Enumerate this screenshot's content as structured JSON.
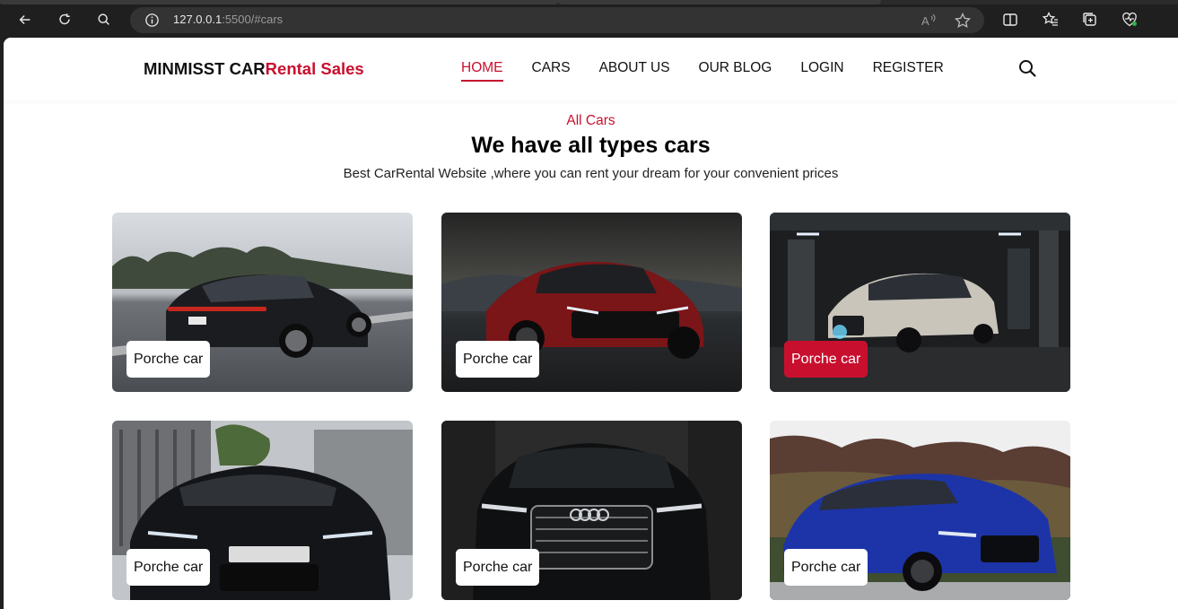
{
  "browser": {
    "url_host": "127.0.0.1",
    "url_rest": ":5500/#cars",
    "icons": [
      "back-icon",
      "refresh-icon",
      "search-icon",
      "info-icon",
      "read-aloud-icon",
      "favorite-star-icon",
      "split-screen-icon",
      "favorites-icon",
      "collections-icon",
      "browser-essentials-icon"
    ]
  },
  "header": {
    "logo_main": "MINMISST CAR",
    "logo_accent": "Rental Sales",
    "nav": [
      "HOME",
      "CARS",
      "ABOUT US",
      "OUR BLOG",
      "LOGIN",
      "REGISTER"
    ],
    "active_nav": "HOME"
  },
  "section": {
    "subtitle": "All Cars",
    "title": "We have all types cars",
    "description": "Best CarRental Website ,where you can rent your dream for your convenient prices"
  },
  "cars": [
    {
      "label": "Porche car",
      "active": false
    },
    {
      "label": "Porche car",
      "active": false
    },
    {
      "label": "Porche car",
      "active": true
    },
    {
      "label": "Porche car",
      "active": false
    },
    {
      "label": "Porche car",
      "active": false
    },
    {
      "label": "Porche car",
      "active": false
    }
  ],
  "colors": {
    "accent": "#c8102e",
    "text": "#111111"
  }
}
